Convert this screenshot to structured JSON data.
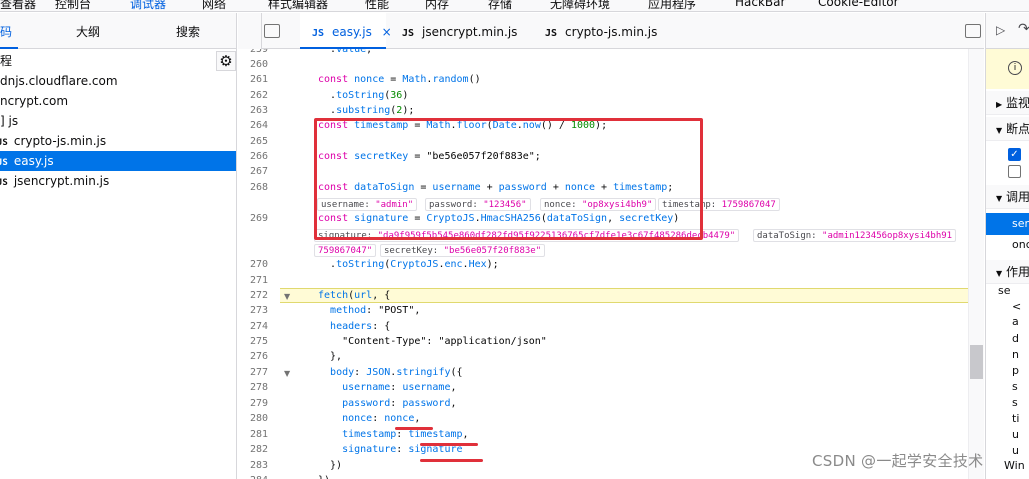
{
  "toolbar": {
    "items": [
      "查看器",
      "控制台",
      "调试器",
      "网络",
      "样式编辑器",
      "性能",
      "内存",
      "存储",
      "无障碍环境",
      "应用程序",
      "HackBar",
      "Cookie-Editor"
    ]
  },
  "left_panel": {
    "tabs": [
      "码",
      "大纲",
      "搜索"
    ],
    "sources": [
      {
        "label": "程"
      },
      {
        "label": "dnjs.cloudflare.com"
      },
      {
        "label": "ncrypt.com"
      },
      {
        "label": "] js"
      },
      {
        "label": "crypto-js.min.js",
        "icon": "JS"
      },
      {
        "label": "easy.js",
        "icon": "JS"
      },
      {
        "label": "jsencrypt.min.js",
        "icon": "JS"
      }
    ]
  },
  "editor": {
    "tabs": [
      {
        "label": "easy.js",
        "icon": "JS",
        "close": "×"
      },
      {
        "label": "jsencrypt.min.js",
        "icon": "JS"
      },
      {
        "label": "crypto-js.min.js",
        "icon": "JS"
      }
    ],
    "lines": [
      {
        "n": "259",
        "code": "  .value;"
      },
      {
        "n": "260",
        "code": ""
      },
      {
        "n": "261",
        "code": "const nonce = Math.random()"
      },
      {
        "n": "262",
        "code": "  .toString(36)"
      },
      {
        "n": "263",
        "code": "  .substring(2);"
      },
      {
        "n": "264",
        "code": "const timestamp = Math.floor(Date.now() / 1000);"
      },
      {
        "n": "265",
        "code": ""
      },
      {
        "n": "266",
        "code": "const secretKey = \"be56e057f20f883e\";"
      },
      {
        "n": "267",
        "code": ""
      },
      {
        "n": "268",
        "code": "const dataToSign = username + password + nonce + timestamp;"
      },
      {
        "n": "269",
        "code": "const signature = CryptoJS.HmacSHA256(dataToSign, secretKey)"
      },
      {
        "n": "270",
        "code": "  .toString(CryptoJS.enc.Hex);"
      },
      {
        "n": "271",
        "code": ""
      },
      {
        "n": "272",
        "code": "fetch(url, {"
      },
      {
        "n": "273",
        "code": "  method: \"POST\","
      },
      {
        "n": "274",
        "code": "  headers: {"
      },
      {
        "n": "275",
        "code": "    \"Content-Type\": \"application/json\""
      },
      {
        "n": "276",
        "code": "  },"
      },
      {
        "n": "277",
        "code": "  body: JSON.stringify({"
      },
      {
        "n": "278",
        "code": "    username: username,"
      },
      {
        "n": "279",
        "code": "    password: password,"
      },
      {
        "n": "280",
        "code": "    nonce: nonce,"
      },
      {
        "n": "281",
        "code": "    timestamp: timestamp,"
      },
      {
        "n": "282",
        "code": "    signature: signature"
      },
      {
        "n": "283",
        "code": "  })"
      },
      {
        "n": "284",
        "code": "})"
      }
    ],
    "inline_values_268": [
      {
        "k": "username:",
        "v": "\"admin\""
      },
      {
        "k": "password:",
        "v": "\"123456\""
      },
      {
        "k": "nonce:",
        "v": "\"op8xysi4bh9\""
      },
      {
        "k": "timestamp:",
        "v": "1759867047"
      }
    ],
    "inline_values_269": [
      {
        "k": "signature:",
        "v": "\"da9f959f5b545e860df282fd95f9225136765cf7dfe1e3c67f485286decb4479\""
      },
      {
        "k": "dataToSign:",
        "v": "\"admin123456op8xysi4bh91"
      },
      {
        "k": "",
        "v": "759867047\""
      },
      {
        "k": "secretKey:",
        "v": "\"be56e057f20f883e\""
      }
    ]
  },
  "right_panel": {
    "sections": [
      "监视",
      "断点",
      "调用",
      "作用"
    ],
    "call_items": [
      "sen",
      "onc"
    ],
    "scope_items": [
      "se",
      "<",
      "a",
      "d",
      "n",
      "p",
      "s",
      "s",
      "ti",
      "u",
      "u"
    ],
    "bottom": "Win"
  },
  "watermark": "CSDN @一起学安全技术"
}
